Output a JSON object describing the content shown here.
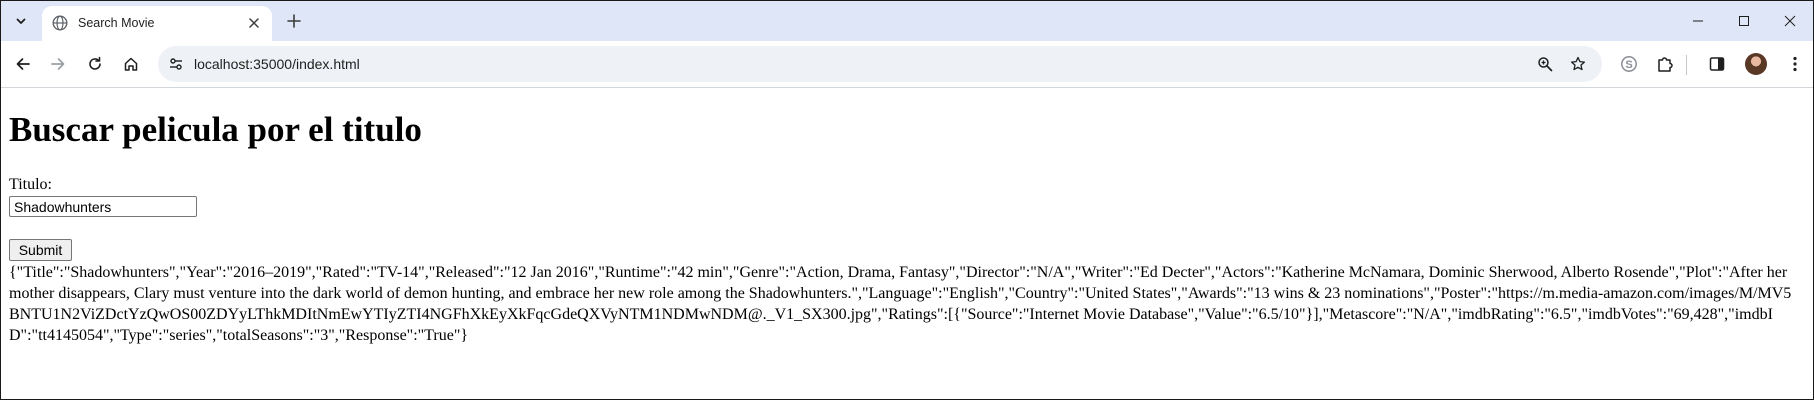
{
  "browser": {
    "tab": {
      "title": "Search Movie"
    },
    "address": {
      "url": "localhost:35000/index.html"
    }
  },
  "page": {
    "heading": "Buscar pelicula por el titulo",
    "field_label": "Titulo:",
    "input_value": "Shadowhunters",
    "submit_label": "Submit",
    "result_json": "{\"Title\":\"Shadowhunters\",\"Year\":\"2016–2019\",\"Rated\":\"TV-14\",\"Released\":\"12 Jan 2016\",\"Runtime\":\"42 min\",\"Genre\":\"Action, Drama, Fantasy\",\"Director\":\"N/A\",\"Writer\":\"Ed Decter\",\"Actors\":\"Katherine McNamara, Dominic Sherwood, Alberto Rosende\",\"Plot\":\"After her mother disappears, Clary must venture into the dark world of demon hunting, and embrace her new role among the Shadowhunters.\",\"Language\":\"English\",\"Country\":\"United States\",\"Awards\":\"13 wins & 23 nominations\",\"Poster\":\"https://m.media-amazon.com/images/M/MV5BNTU1N2ViZDctYzQwOS00ZDYyLThkMDItNmEwYTIyZTI4NGFhXkEyXkFqcGdeQXVyNTM1NDMwNDM@._V1_SX300.jpg\",\"Ratings\":[{\"Source\":\"Internet Movie Database\",\"Value\":\"6.5/10\"}],\"Metascore\":\"N/A\",\"imdbRating\":\"6.5\",\"imdbVotes\":\"69,428\",\"imdbID\":\"tt4145054\",\"Type\":\"series\",\"totalSeasons\":\"3\",\"Response\":\"True\"}"
  },
  "icons": {
    "tab_search": "chevron-down-icon",
    "favicon": "globe-icon",
    "tab_close": "close-icon",
    "new_tab": "plus-icon",
    "back": "arrow-left-icon",
    "forward": "arrow-right-icon",
    "reload": "reload-icon",
    "home": "home-icon",
    "site_info": "site-info-icon",
    "zoom": "zoom-icon",
    "bookmark": "star-icon",
    "skype": "skype-icon",
    "extensions": "puzzle-icon",
    "side_panel": "side-panel-icon",
    "profile": "avatar",
    "menu": "kebab-menu-icon",
    "minimize": "minimize-icon",
    "maximize": "maximize-icon",
    "close_window": "close-window-icon"
  },
  "colors": {
    "tabstrip": "#dee6f7",
    "omnibox": "#eef1f6",
    "button_bg": "#efefef"
  }
}
